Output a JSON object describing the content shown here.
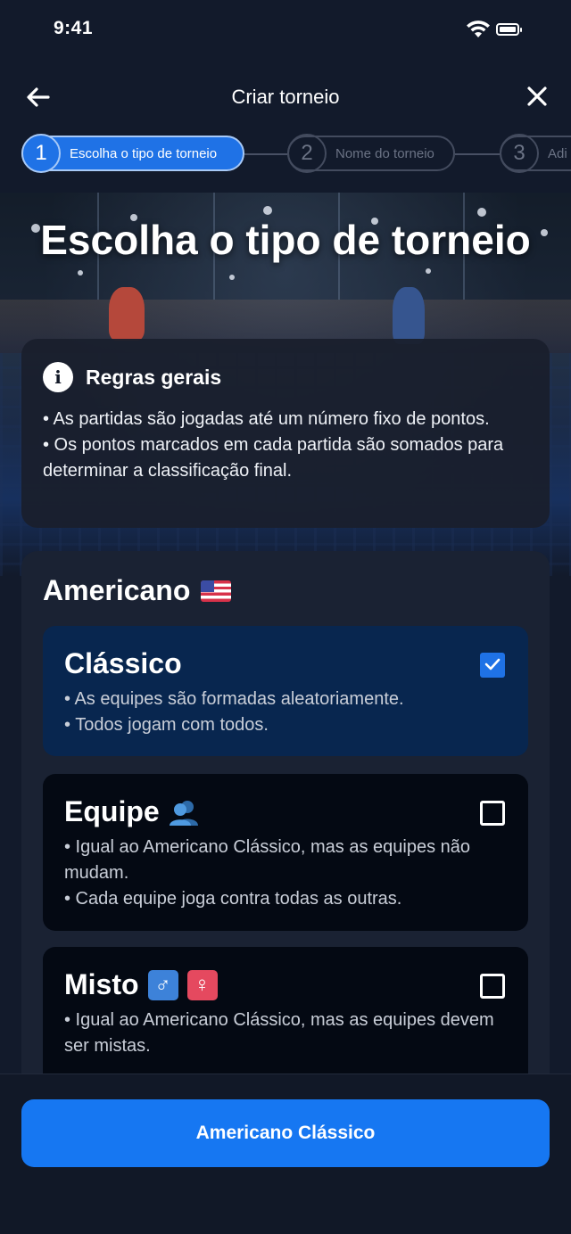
{
  "status_bar": {
    "time": "9:41"
  },
  "nav": {
    "title": "Criar torneio"
  },
  "stepper": {
    "steps": [
      {
        "number": "1",
        "label": "Escolha o tipo de torneio",
        "active": true
      },
      {
        "number": "2",
        "label": "Nome do torneio",
        "active": false
      },
      {
        "number": "3",
        "label": "Adi",
        "active": false
      }
    ]
  },
  "hero": {
    "title": "Escolha o tipo de torneio"
  },
  "rules": {
    "title": "Regras gerais",
    "line1": "• As partidas são jogadas até um número fixo de pontos.",
    "line2": "• Os pontos marcados em cada partida são somados para determinar a classificação final."
  },
  "americano": {
    "title": "Americano",
    "options": [
      {
        "title": "Clássico",
        "checked": true,
        "desc1": "• As equipes são formadas aleatoriamente.",
        "desc2": "• Todos jogam com todos."
      },
      {
        "title": "Equipe",
        "checked": false,
        "desc1": "• Igual ao Americano Clássico, mas as equipes não mudam.",
        "desc2": "• Cada equipe joga contra todas as outras."
      },
      {
        "title": "Misto",
        "checked": false,
        "desc1": "• Igual ao Americano Clássico, mas as equipes devem ser mistas."
      }
    ]
  },
  "footer": {
    "button_label": "Americano Clássico"
  },
  "colors": {
    "accent": "#1677f2",
    "selected_bg": "#08264f",
    "card_bg": "#1a2233",
    "page_bg": "#121a2b"
  }
}
